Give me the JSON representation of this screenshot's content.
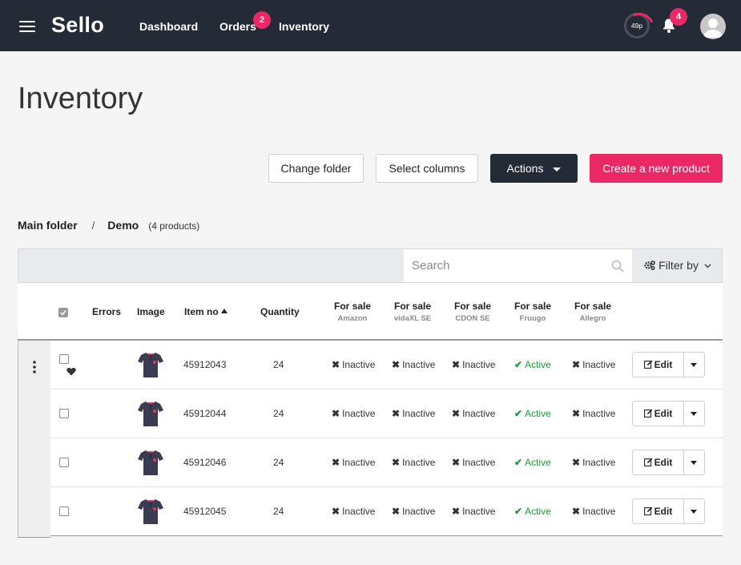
{
  "nav": {
    "logo": "Sello",
    "links": [
      {
        "label": "Dashboard"
      },
      {
        "label": "Orders",
        "badge": "2"
      },
      {
        "label": "Inventory"
      }
    ],
    "usage": "49p",
    "notifications": "4"
  },
  "page": {
    "title": "Inventory",
    "buttons": {
      "change_folder": "Change folder",
      "select_columns": "Select columns",
      "actions": "Actions",
      "create": "Create a new product"
    }
  },
  "breadcrumb": {
    "main": "Main folder",
    "separator": "/",
    "current": "Demo",
    "count": "(4 products)"
  },
  "search": {
    "placeholder": "Search",
    "filter_label": "Filter by"
  },
  "table": {
    "headers": {
      "errors": "Errors",
      "image": "Image",
      "item_no": "Item no",
      "quantity": "Quantity",
      "channels": [
        {
          "label": "For sale",
          "sub": "Amazon"
        },
        {
          "label": "For sale",
          "sub": "vidaXL SE"
        },
        {
          "label": "For sale",
          "sub": "CDON SE"
        },
        {
          "label": "For sale",
          "sub": "Fruugo"
        },
        {
          "label": "For sale",
          "sub": "Allegro"
        }
      ]
    },
    "edit_label": "Edit",
    "rows": [
      {
        "item_no": "45912043",
        "quantity": "24",
        "statuses": [
          "Inactive",
          "Inactive",
          "Inactive",
          "Active",
          "Inactive"
        ]
      },
      {
        "item_no": "45912044",
        "quantity": "24",
        "statuses": [
          "Inactive",
          "Inactive",
          "Inactive",
          "Active",
          "Inactive"
        ]
      },
      {
        "item_no": "45912046",
        "quantity": "24",
        "statuses": [
          "Inactive",
          "Inactive",
          "Inactive",
          "Active",
          "Inactive"
        ]
      },
      {
        "item_no": "45912045",
        "quantity": "24",
        "statuses": [
          "Inactive",
          "Inactive",
          "Inactive",
          "Active",
          "Inactive"
        ]
      }
    ]
  },
  "colors": {
    "nav_bg": "#252a37",
    "accent": "#ea2865",
    "active": "#1f9a3a"
  }
}
